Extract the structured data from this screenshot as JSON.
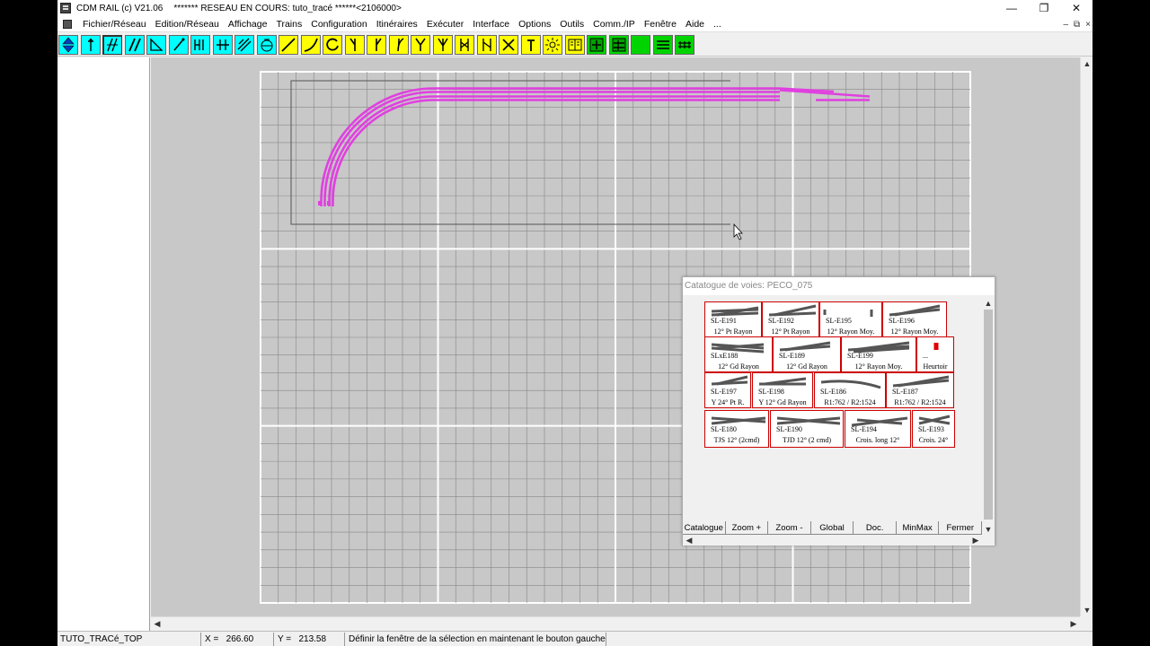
{
  "window": {
    "app_title": "CDM RAIL (c) V21.06",
    "network_title": "******* RESEAU EN COURS: tuto_tracé ******<2106000>",
    "buttons": [
      "—",
      "❐",
      "✕"
    ]
  },
  "menu": {
    "items": [
      "Fichier/Réseau",
      "Edition/Réseau",
      "Affichage",
      "Trains",
      "Configuration",
      "Itinéraires",
      "Exécuter",
      "Interface",
      "Options",
      "Outils",
      "Comm./IP",
      "Fenêtre",
      "Aide",
      "..."
    ],
    "mdi_buttons": [
      "–",
      "⧉",
      "×"
    ]
  },
  "toolbar": {
    "tools": [
      {
        "icon": "move-up-down-icon",
        "color": "#00ffff"
      },
      {
        "icon": "track-point-icon",
        "color": "#00ffff"
      },
      {
        "icon": "double-track-icon",
        "color": "#00ffff"
      },
      {
        "icon": "double-slash-icon",
        "color": "#00ffff"
      },
      {
        "icon": "triangle-icon",
        "color": "#00ffff"
      },
      {
        "icon": "connect-icon",
        "color": "#00ffff"
      },
      {
        "icon": "signal-icon",
        "color": "#00ffff"
      },
      {
        "icon": "level-crossing-icon",
        "color": "#00ffff"
      },
      {
        "icon": "hatched-icon",
        "color": "#00ffff"
      },
      {
        "icon": "turntable-icon",
        "color": "#00ffff"
      },
      {
        "icon": "straight-track-icon",
        "color": "#ffff00"
      },
      {
        "icon": "curved-track-icon",
        "color": "#ffff00"
      },
      {
        "icon": "circle-track-icon",
        "color": "#ffff00"
      },
      {
        "icon": "left-turnout-icon",
        "color": "#ffff00"
      },
      {
        "icon": "right-turnout-icon",
        "color": "#ffff00"
      },
      {
        "icon": "curved-turnout-icon",
        "color": "#ffff00"
      },
      {
        "icon": "y-turnout-icon",
        "color": "#ffff00"
      },
      {
        "icon": "three-way-icon",
        "color": "#ffff00"
      },
      {
        "icon": "double-slip-icon",
        "color": "#ffff00"
      },
      {
        "icon": "single-slip-icon",
        "color": "#ffff00"
      },
      {
        "icon": "crossing-icon",
        "color": "#ffff00"
      },
      {
        "icon": "buffer-stop-icon",
        "color": "#ffff00"
      },
      {
        "icon": "sun-icon",
        "color": "#ffff00"
      },
      {
        "icon": "book-icon",
        "color": "#ffff00"
      },
      {
        "icon": "layout-icon",
        "color": "#00d400"
      },
      {
        "icon": "layout-b-icon",
        "color": "#00d400"
      },
      {
        "icon": "solid-green-icon",
        "color": "#00d400"
      },
      {
        "icon": "lines-icon",
        "color": "#00d400"
      },
      {
        "icon": "rail-icon",
        "color": "#00d400"
      }
    ]
  },
  "canvas": {
    "track_color": "#e040e0",
    "grid_color": "#888888",
    "board_color": "#c8c8c8"
  },
  "catalogue": {
    "title": "Catatogue de voies: PECO_075",
    "rows": [
      [
        {
          "ref": "SL-E191",
          "desc": "12° Pt Rayon"
        },
        {
          "ref": "SL-E192",
          "desc": "12° Pt Rayon"
        },
        {
          "ref": "SL-E195",
          "desc": "12° Rayon Moy."
        },
        {
          "ref": "SL-E196",
          "desc": "12° Rayon Moy."
        }
      ],
      [
        {
          "ref": "SLxE188",
          "desc": "12° Gd Rayon"
        },
        {
          "ref": "SL-E189",
          "desc": "12° Gd Rayon"
        },
        {
          "ref": "SL-E199",
          "desc": "12° Rayon Moy."
        },
        {
          "ref": "...",
          "desc": "Heurtoir"
        }
      ],
      [
        {
          "ref": "SL-E197",
          "desc": "Y 24° Pt R."
        },
        {
          "ref": "SL-E198",
          "desc": "Y 12° Gd Rayon"
        },
        {
          "ref": "SL-E186",
          "desc": "R1:762 / R2:1524"
        },
        {
          "ref": "SL-E187",
          "desc": "R1:762 / R2:1524"
        }
      ],
      [
        {
          "ref": "SL-E180",
          "desc": "TJS 12° (2cmd)"
        },
        {
          "ref": "SL-E190",
          "desc": "TJD 12° (2 cmd)"
        },
        {
          "ref": "SL-E194",
          "desc": "Crois. long 12°"
        },
        {
          "ref": "SL-E193",
          "desc": "Crois. 24°"
        }
      ]
    ],
    "buttons": [
      "Catalogue",
      "Zoom +",
      "Zoom -",
      "Global",
      "Doc.",
      "MinMax",
      "Fermer"
    ]
  },
  "status": {
    "layer": "TUTO_TRACé_TOP",
    "x_label": "X =",
    "x_value": "266.60",
    "y_label": "Y =",
    "y_value": "213.58",
    "message": "Définir la fenêtre de la sélection en maintenant le bouton gauche er"
  }
}
